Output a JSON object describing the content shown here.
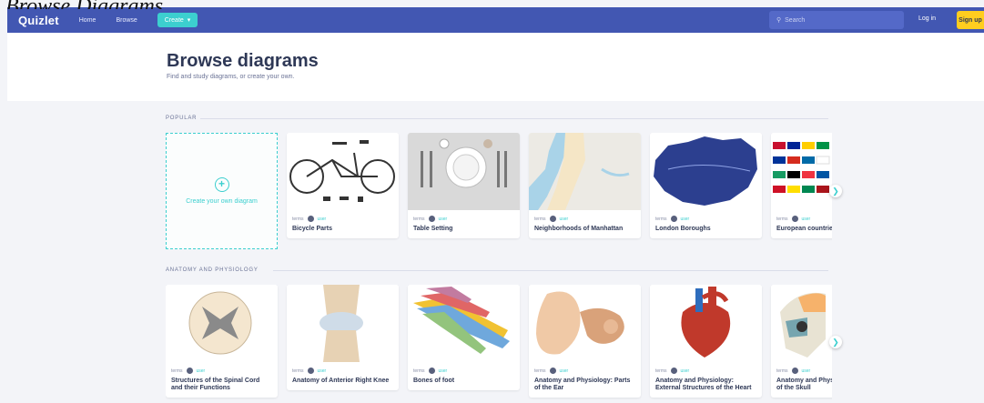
{
  "page_caption": "Browse Diagrams",
  "topbar": {
    "logo": "Quizlet",
    "nav": [
      "Home",
      "Browse"
    ],
    "create_label": "Create",
    "search_placeholder": "Search",
    "login": "Log in",
    "signup": "Sign up"
  },
  "hero": {
    "title": "Browse diagrams",
    "subtitle": "Find and study diagrams, or create your own."
  },
  "sections": [
    {
      "label": "Popular",
      "create_card_label": "Create your own diagram",
      "cards": [
        {
          "terms": "terms",
          "user": "user",
          "title": "Bicycle Parts"
        },
        {
          "terms": "terms",
          "user": "user",
          "title": "Table Setting"
        },
        {
          "terms": "terms",
          "user": "user",
          "title": "Neighborhoods of Manhattan"
        },
        {
          "terms": "terms",
          "user": "user",
          "title": "London Boroughs"
        },
        {
          "terms": "terms",
          "user": "user",
          "title": "European countries"
        }
      ]
    },
    {
      "label": "Anatomy and Physiology",
      "cards": [
        {
          "terms": "terms",
          "user": "user",
          "title": "Structures of the Spinal Cord and their Functions"
        },
        {
          "terms": "terms",
          "user": "user",
          "title": "Anatomy of Anterior Right Knee"
        },
        {
          "terms": "terms",
          "user": "user",
          "title": "Bones of foot"
        },
        {
          "terms": "terms",
          "user": "user",
          "title": "Anatomy and Physiology: Parts of the Ear"
        },
        {
          "terms": "terms",
          "user": "user",
          "title": "Anatomy and Physiology: External Structures of the Heart"
        },
        {
          "terms": "terms",
          "user": "user",
          "title": "Anatomy and Physiology: Bones of the Skull"
        }
      ]
    }
  ],
  "colors": {
    "brand_blue": "#4257b2",
    "accent_teal": "#3ccfcf",
    "signup_yellow": "#ffcd1f"
  }
}
